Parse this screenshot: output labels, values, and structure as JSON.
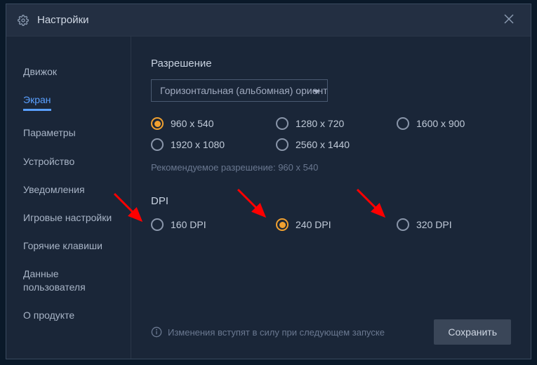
{
  "titlebar": {
    "title": "Настройки"
  },
  "sidebar": {
    "items": [
      {
        "label": "Движок"
      },
      {
        "label": "Экран"
      },
      {
        "label": "Параметры"
      },
      {
        "label": "Устройство"
      },
      {
        "label": "Уведомления"
      },
      {
        "label": "Игровые настройки"
      },
      {
        "label": "Горячие клавиши"
      },
      {
        "label": "Данные пользователя"
      },
      {
        "label": "О продукте"
      }
    ],
    "activeIndex": 1
  },
  "resolution": {
    "title": "Разрешение",
    "orientation": "Горизонтальная (альбомная) ориентация",
    "options": [
      "960 x 540",
      "1280 x 720",
      "1600 x 900",
      "1920 x 1080",
      "2560 x 1440"
    ],
    "selected": "960 x 540",
    "recommendation": "Рекомендуемое разрешение: 960 x 540"
  },
  "dpi": {
    "title": "DPI",
    "options": [
      "160 DPI",
      "240 DPI",
      "320 DPI"
    ],
    "selected": "240 DPI"
  },
  "footer": {
    "info": "Изменения вступят в силу при следующем запуске",
    "save": "Сохранить"
  }
}
